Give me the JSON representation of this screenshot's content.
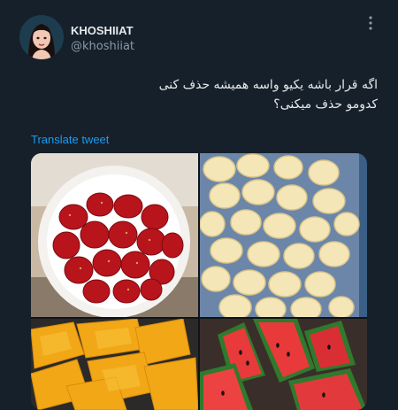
{
  "author": {
    "display_name": "KHOSHIIAT",
    "handle": "@khoshiiat",
    "avatar_icon": "cartoon-girl-avatar-icon"
  },
  "tweet": {
    "text_lines": [
      "اگه قرار باشه یکیو واسه همیشه حذف کنی",
      "کدومو حذف میکنی؟"
    ],
    "translate_label": "Translate tweet"
  },
  "media": {
    "images": [
      {
        "name": "strawberries-photo"
      },
      {
        "name": "bananas-photo"
      },
      {
        "name": "mango-photo"
      },
      {
        "name": "watermelon-photo"
      }
    ]
  },
  "colors": {
    "background": "#15202b",
    "text": "#e7e9ea",
    "secondary_text": "#8b98a5",
    "link": "#1d9bf0"
  }
}
